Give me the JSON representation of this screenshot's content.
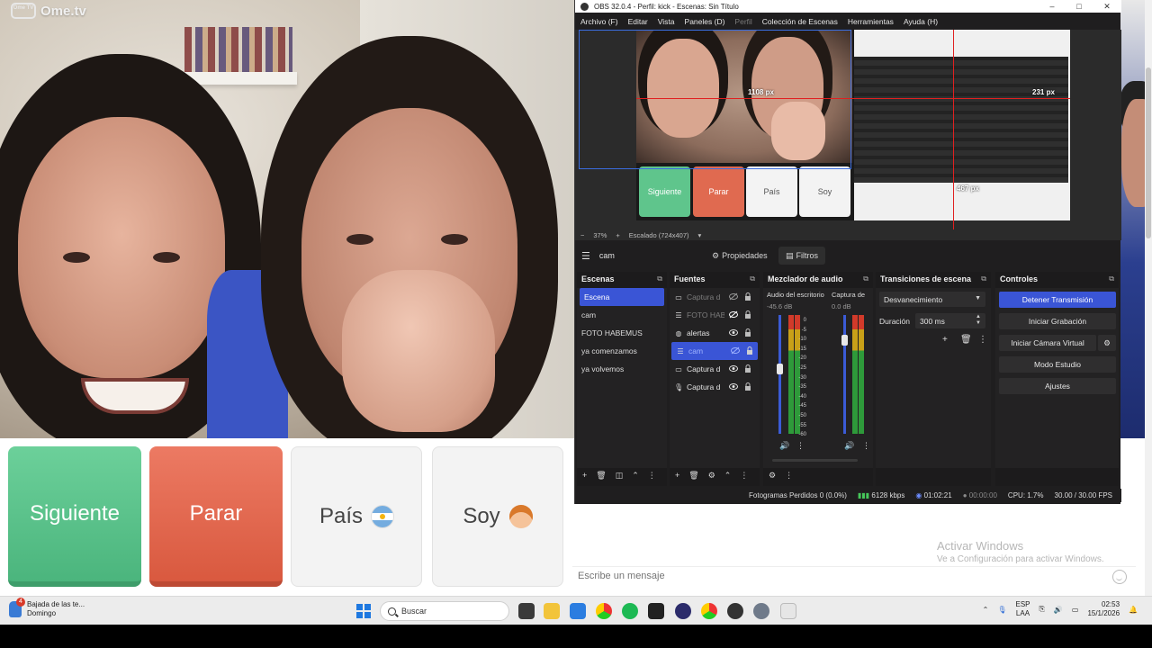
{
  "ometv": {
    "logo_badge": "Ome TV",
    "logo_text": "Ome.tv",
    "buttons": {
      "next": "Siguiente",
      "stop": "Parar",
      "country": "País",
      "soy": "Soy"
    },
    "message_placeholder": "Escribe un mensaje",
    "activate_windows_title": "Activar Windows",
    "activate_windows_sub": "Ve a Configuración para activar Windows."
  },
  "obs": {
    "title": "OBS 32.0.4 - Perfil: kick - Escenas: Sin Título",
    "menu": [
      "Archivo (F)",
      "Editar",
      "Vista",
      "Paneles (D)",
      "Perfil",
      "Colección de Escenas",
      "Herramientas",
      "Ayuda (H)"
    ],
    "preview": {
      "buttons": [
        "Siguiente",
        "Parar",
        "País",
        "Soy"
      ],
      "px_labels": [
        "1108 px",
        "231 px",
        "467 px"
      ],
      "zoom": "37%",
      "scale": "Escalado (724x407)"
    },
    "source_bar": {
      "current_source": "cam",
      "properties": "Propiedades",
      "filters": "Filtros"
    },
    "scenes": {
      "title": "Escenas",
      "items": [
        "Escena",
        "cam",
        "FOTO HABEMUS",
        "ya comenzamos",
        "ya volvemos"
      ],
      "active_index": 0
    },
    "sources": {
      "title": "Fuentes",
      "items": [
        {
          "name": "Captura d",
          "icon": "monitor-icon",
          "visible": false
        },
        {
          "name": "FOTO HAB",
          "icon": "list-icon",
          "visible": false
        },
        {
          "name": "alertas",
          "icon": "globe-icon",
          "visible": true
        },
        {
          "name": "cam",
          "icon": "list-icon",
          "visible": false,
          "selected": true
        },
        {
          "name": "Captura d",
          "icon": "monitor-icon",
          "visible": true
        },
        {
          "name": "Captura d",
          "icon": "mic-icon",
          "visible": true
        }
      ]
    },
    "mixer": {
      "title": "Mezclador de audio",
      "channels": [
        {
          "name": "Audio del escritorio",
          "db": "-45.6 dB",
          "level": 0.55
        },
        {
          "name": "Captura de",
          "db": "0.0 dB",
          "level": 0.82
        }
      ],
      "scale": [
        "0",
        "-5",
        "-10",
        "-15",
        "-20",
        "-25",
        "-30",
        "-35",
        "-40",
        "-45",
        "-50",
        "-55",
        "-60"
      ]
    },
    "transitions": {
      "title": "Transiciones de escena",
      "selected": "Desvanecimiento",
      "duration_label": "Duración",
      "duration_value": "300 ms"
    },
    "controls": {
      "title": "Controles",
      "stop_stream": "Detener Transmisión",
      "start_recording": "Iniciar Grabación",
      "virtual_cam": "Iniciar Cámara Virtual",
      "studio_mode": "Modo Estudio",
      "settings": "Ajustes"
    },
    "status": {
      "dropped_frames": "Fotogramas Perdidos 0 (0.0%)",
      "bitrate": "6128 kbps",
      "stream_time": "01:02:21",
      "rec_time": "00:00:00",
      "cpu": "CPU: 1.7%",
      "fps": "30.00 / 30.00 FPS"
    },
    "colors": {
      "accent": "#3a55d6",
      "live_green": "#46c85a"
    }
  },
  "taskbar": {
    "news_title": "Bajada de las te...",
    "news_sub": "Domingo",
    "news_badge": "4",
    "search_placeholder": "Buscar",
    "lang_top": "ESP",
    "lang_bottom": "LAA",
    "time": "02:53",
    "date": "15/1/2026"
  }
}
